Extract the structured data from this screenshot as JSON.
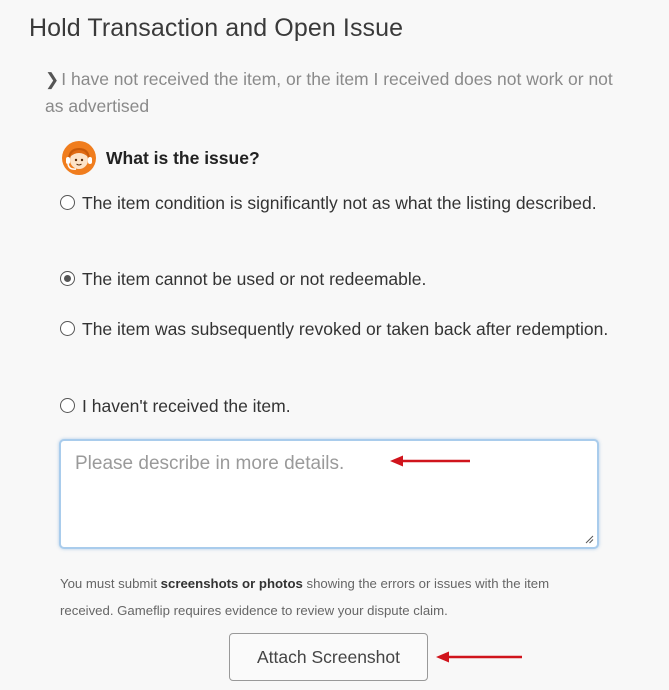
{
  "page": {
    "title": "Hold Transaction and Open Issue",
    "breadcrumb": "I have not received the item, or the item I received does not work or not as advertised"
  },
  "question": {
    "label": "What is the issue?",
    "icon": "support-agent-icon"
  },
  "options": [
    {
      "label": "The item condition is significantly not as what the listing described.",
      "checked": false
    },
    {
      "label": "The item cannot be used or not redeemable.",
      "checked": true
    },
    {
      "label": "The item was subsequently revoked or taken back after redemption.",
      "checked": false
    },
    {
      "label": "I haven't received the item.",
      "checked": false
    }
  ],
  "details": {
    "placeholder": "Please describe in more details.",
    "value": ""
  },
  "notice": {
    "before": "You must submit ",
    "bold": "screenshots or photos",
    "after": " showing the errors or issues with the item received. Gameflip requires evidence to review your dispute claim."
  },
  "attach_button": {
    "label": "Attach Screenshot"
  },
  "colors": {
    "annotation_arrow": "#d0141c",
    "agent_icon": "#f07d1e",
    "focus_border": "#a9ccec"
  }
}
